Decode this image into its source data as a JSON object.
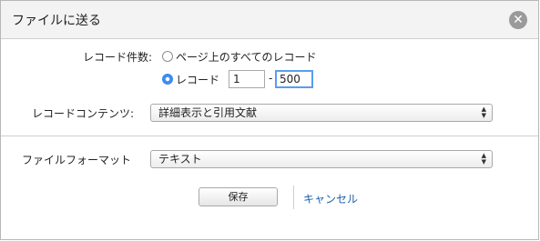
{
  "dialog": {
    "title": "ファイルに送る",
    "close_icon": "close-icon"
  },
  "record_count": {
    "label": "レコード件数:",
    "option_all_label": "ページ上のすべてのレコード",
    "option_range_label": "レコード",
    "selected": "range",
    "range_from": "1",
    "range_separator": "-",
    "range_to": "500"
  },
  "record_content": {
    "label": "レコードコンテンツ:",
    "selected": "詳細表示と引用文献"
  },
  "file_format": {
    "label": "ファイルフォーマット",
    "selected": "テキスト"
  },
  "actions": {
    "save_label": "保存",
    "cancel_label": "キャンセル"
  },
  "colors": {
    "accent": "#3b8cf2",
    "link": "#1a5fa6",
    "focus": "#5b9ded"
  }
}
